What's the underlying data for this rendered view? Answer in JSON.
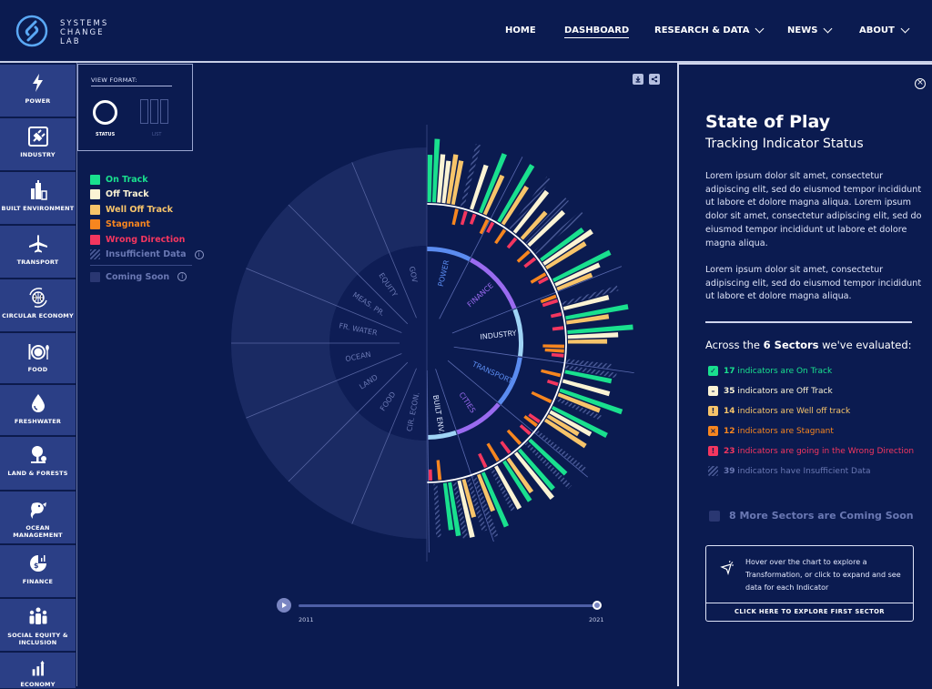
{
  "brand": {
    "name_lines": [
      "SYSTEMS",
      "CHANGE",
      "LAB"
    ]
  },
  "nav": [
    {
      "label": "HOME",
      "dropdown": false,
      "active": false
    },
    {
      "label": "DASHBOARD",
      "dropdown": false,
      "active": true
    },
    {
      "label": "RESEARCH & DATA",
      "dropdown": true,
      "active": false
    },
    {
      "label": "NEWS",
      "dropdown": true,
      "active": false
    },
    {
      "label": "ABOUT",
      "dropdown": true,
      "active": false
    }
  ],
  "sidebar": [
    {
      "label": "POWER",
      "icon": "lightning-icon"
    },
    {
      "label": "INDUSTRY",
      "icon": "plug-icon"
    },
    {
      "label": "BUILT ENVIRONMENT",
      "icon": "buildings-icon"
    },
    {
      "label": "TRANSPORT",
      "icon": "airplane-icon"
    },
    {
      "label": "CIRCULAR ECONOMY",
      "icon": "globe-recycle-icon"
    },
    {
      "label": "FOOD",
      "icon": "plate-cutlery-icon"
    },
    {
      "label": "FRESHWATER",
      "icon": "water-drop-icon"
    },
    {
      "label": "LAND & FORESTS",
      "icon": "tree-icon"
    },
    {
      "label": "OCEAN MANAGEMENT",
      "icon": "fish-icon"
    },
    {
      "label": "FINANCE",
      "icon": "finance-pie-icon"
    },
    {
      "label": "SOCIAL EQUITY & INCLUSION",
      "icon": "people-icon"
    },
    {
      "label": "ECONOMY",
      "icon": "bar-growth-icon"
    }
  ],
  "view_format": {
    "title": "VIEW FORMAT:",
    "options": [
      "STATUS",
      "LIST"
    ],
    "selected": "STATUS"
  },
  "legend": {
    "items": [
      {
        "label": "On Track",
        "color": "#19e08e"
      },
      {
        "label": "Off Track",
        "color": "#fbf3d4"
      },
      {
        "label": "Well Off Track",
        "color": "#f7c46a"
      },
      {
        "label": "Stagnant",
        "color": "#f7861f"
      },
      {
        "label": "Wrong Direction",
        "color": "#f4365f"
      }
    ],
    "insufficient": "Insufficient Data",
    "coming_soon": "Coming Soon"
  },
  "timeline": {
    "start": "2011",
    "end": "2021",
    "selected": "2021"
  },
  "chart_data": {
    "type": "radial-bar",
    "title": "State of Play",
    "status_colors": {
      "on": "#19e08e",
      "off": "#fbf3d4",
      "well": "#f7c46a",
      "stag": "#f7861f",
      "wrong": "#f4365f",
      "na": "hatch"
    },
    "active_sectors": [
      {
        "name": "POWER",
        "color": "#5b8cf0",
        "indicators": [
          "on",
          "on",
          "off",
          "off",
          "well",
          "well",
          "stag",
          "na",
          "wrong",
          "off",
          "wrong",
          "on",
          "well",
          "stag"
        ]
      },
      {
        "name": "FINANCE",
        "color": "#9a6bf0",
        "indicators": [
          "wrong",
          "on",
          "well",
          "stag",
          "na",
          "off",
          "wrong",
          "well",
          "na",
          "off",
          "stag",
          "na",
          "wrong",
          "on",
          "off",
          "well",
          "stag",
          "wrong",
          "on",
          "off",
          "well"
        ]
      },
      {
        "name": "INDUSTRY",
        "color": "#9fd4f5",
        "indicators": [
          "stag",
          "wrong",
          "na",
          "off",
          "wrong",
          "on",
          "well",
          "wrong",
          "on",
          "off",
          "well",
          "stag",
          "stag",
          "wrong",
          "na"
        ]
      },
      {
        "name": "TRANSPORT",
        "color": "#5b8cf0",
        "indicators": [
          "na",
          "on",
          "stag",
          "off",
          "wrong",
          "on",
          "well",
          "na",
          "stag",
          "on",
          "off",
          "well",
          "well",
          "wrong",
          "stag",
          "na"
        ]
      },
      {
        "name": "CITIES",
        "color": "#9a6bf0",
        "indicators": [
          "wrong",
          "on",
          "na",
          "stag",
          "on",
          "off",
          "wrong",
          "well",
          "on",
          "stag",
          "off",
          "na",
          "wrong",
          "on",
          "well",
          "na"
        ]
      },
      {
        "name": "BUILT ENV.",
        "color": "#9fd4f5",
        "indicators": [
          "na",
          "well",
          "off",
          "na",
          "on",
          "on",
          "stag",
          "na",
          "wrong"
        ]
      }
    ],
    "coming_soon_sectors": [
      "CIR. ECON.",
      "FOOD",
      "LAND",
      "OCEAN",
      "FR. WATER",
      "MEAS. PR.",
      "EQUITY",
      "GOV"
    ]
  },
  "panel": {
    "title": "State of Play",
    "subtitle": "Tracking Indicator Status",
    "para1": "Lorem ipsum dolor sit amet, consectetur adipiscing elit, sed do eiusmod tempor incididunt ut labore et dolore magna aliqua. Lorem ipsum dolor sit amet, consectetur adipiscing elit, sed do eiusmod tempor incididunt ut labore et dolore magna aliqua.",
    "para2": "Lorem ipsum dolor sit amet, consectetur adipiscing elit, sed do eiusmod tempor incididunt ut labore et dolore magna aliqua.",
    "across_prefix": "Across the ",
    "across_bold": "6 Sectors",
    "across_suffix": " we've evaluated:",
    "stats": [
      {
        "count": "17",
        "text": " indicators are On Track",
        "color": "#19e08e",
        "glyph": "✓"
      },
      {
        "count": "35",
        "text": " indicators are Off Track",
        "color": "#fbf3d4",
        "glyph": "–"
      },
      {
        "count": "14",
        "text": " indicators are Well off track",
        "color": "#f7c46a",
        "glyph": "!"
      },
      {
        "count": "12",
        "text": " indicators are Stagnant",
        "color": "#f7861f",
        "glyph": "×"
      },
      {
        "count": "23",
        "text": " indicators are going in the Wrong Direction",
        "color": "#f4365f",
        "glyph": "!"
      },
      {
        "count": "39",
        "text": " indicators have Insufficient Data",
        "color": "#6a78b3",
        "glyph": ""
      }
    ],
    "coming_soon": "8 More  Sectors are Coming Soon",
    "hover_text": "Hover over the chart to explore a Transformation, or click to expand and see data for each Indicator",
    "explore_button": "CLICK HERE TO EXPLORE FIRST SECTOR"
  }
}
